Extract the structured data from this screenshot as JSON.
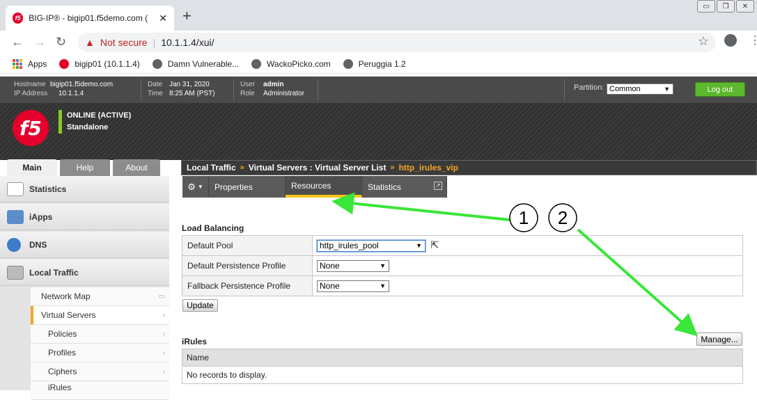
{
  "browser": {
    "tab_title": "BIG-IP® - bigip01.f5demo.com (",
    "tab_favicon": "f5",
    "url_warning": "Not secure",
    "url": "10.1.1.4/xui/",
    "bookmarks": [
      {
        "label": "Apps",
        "icon": "apps-grid-icon"
      },
      {
        "label": "bigip01 (10.1.1.4)",
        "icon": "f5-icon"
      },
      {
        "label": "Damn Vulnerable...",
        "icon": "globe-icon"
      },
      {
        "label": "WackoPicko.com",
        "icon": "globe-icon"
      },
      {
        "label": "Peruggia 1.2",
        "icon": "globe-icon"
      }
    ]
  },
  "header": {
    "hostname_label": "Hostname",
    "hostname": "bigip01.f5demo.com",
    "ip_label": "IP Address",
    "ip": "10.1.1.4",
    "date_label": "Date",
    "date": "Jan 31, 2020",
    "time_label": "Time",
    "time": "8:25 AM (PST)",
    "user_label": "User",
    "user": "admin",
    "role_label": "Role",
    "role": "Administrator",
    "partition_label": "Partition:",
    "partition_value": "Common",
    "logout_label": "Log out"
  },
  "banner": {
    "logo_text": "f5",
    "status_1": "ONLINE (ACTIVE)",
    "status_2": "Standalone",
    "status_color": "#8ac926"
  },
  "nav_tabs": [
    "Main",
    "Help",
    "About"
  ],
  "breadcrumb": {
    "part1": "Local Traffic",
    "part2": "Virtual Servers : Virtual Server List",
    "current": "http_irules_vip",
    "separator": "»"
  },
  "sidebar": {
    "items": [
      {
        "label": "Statistics",
        "icon": "statistics-icon"
      },
      {
        "label": "iApps",
        "icon": "iapps-icon"
      },
      {
        "label": "DNS",
        "icon": "dns-globe-icon"
      },
      {
        "label": "Local Traffic",
        "icon": "local-traffic-icon"
      }
    ],
    "subitems": [
      "Network Map",
      "Virtual Servers",
      "Policies",
      "Profiles",
      "Ciphers",
      "iRules"
    ]
  },
  "subtabs": [
    "Properties",
    "Resources",
    "Statistics"
  ],
  "load_balancing": {
    "title": "Load Balancing",
    "rows": [
      {
        "label": "Default Pool",
        "value": "http_irules_pool"
      },
      {
        "label": "Default Persistence Profile",
        "value": "None"
      },
      {
        "label": "Fallback Persistence Profile",
        "value": "None"
      }
    ],
    "update_label": "Update"
  },
  "irules": {
    "title": "iRules",
    "manage_label": "Manage...",
    "column": "Name",
    "empty": "No records to display."
  },
  "annotations": {
    "marker_1": "①",
    "marker_2": "②",
    "arrow_color": "#39e639"
  }
}
